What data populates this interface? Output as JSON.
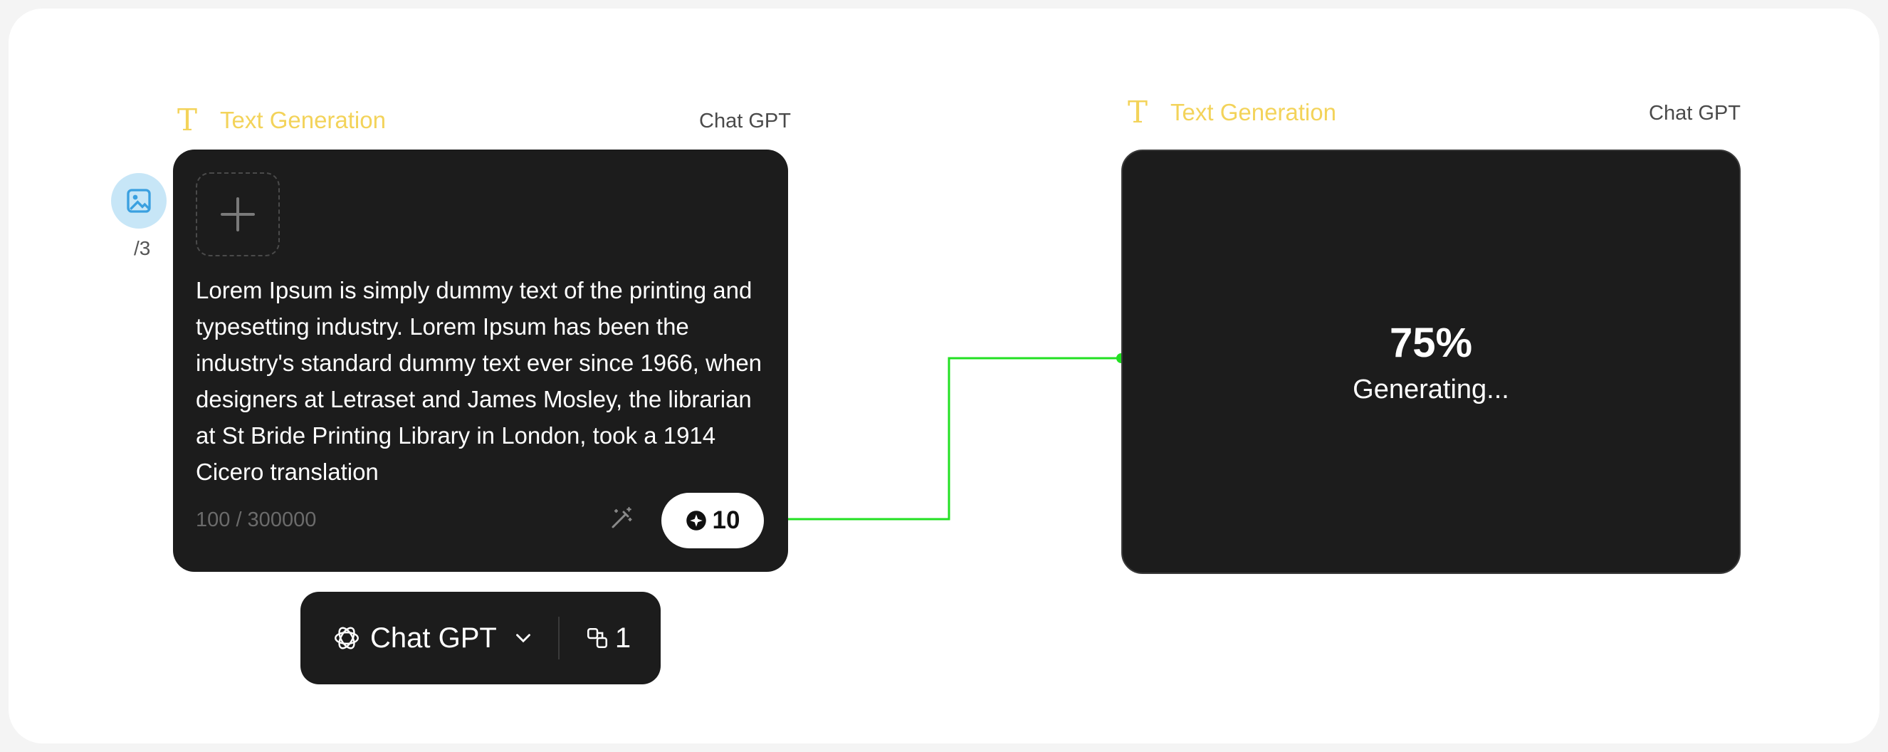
{
  "input_node": {
    "header_icon": "text-t-icon",
    "title": "Text Generation",
    "model_label": "Chat GPT",
    "prompt_text": "Lorem Ipsum is simply dummy text of the printing and typesetting industry. Lorem Ipsum has been the industry's standard dummy text ever since 1966, when designers at Letraset and James Mosley, the librarian at St Bride Printing Library in London, took a 1914 Cicero translation",
    "char_counter": "100 / 300000",
    "credits": "10",
    "image_count": "/3",
    "add_icon": "plus-icon",
    "image_icon": "image-icon"
  },
  "model_bar": {
    "model_icon": "openai-icon",
    "model_name": "Chat GPT",
    "chevron_icon": "chevron-down-icon",
    "variants_icon": "copies-icon",
    "variants_count": "1"
  },
  "output_node": {
    "header_icon": "text-t-icon",
    "title": "Text Generation",
    "model_label": "Chat GPT",
    "progress": "75%",
    "status": "Generating..."
  },
  "colors": {
    "accent_yellow": "#f3d35a",
    "connector_green": "#22e022",
    "card_dark": "#1c1c1c",
    "image_bubble": "#c7e6f7"
  }
}
